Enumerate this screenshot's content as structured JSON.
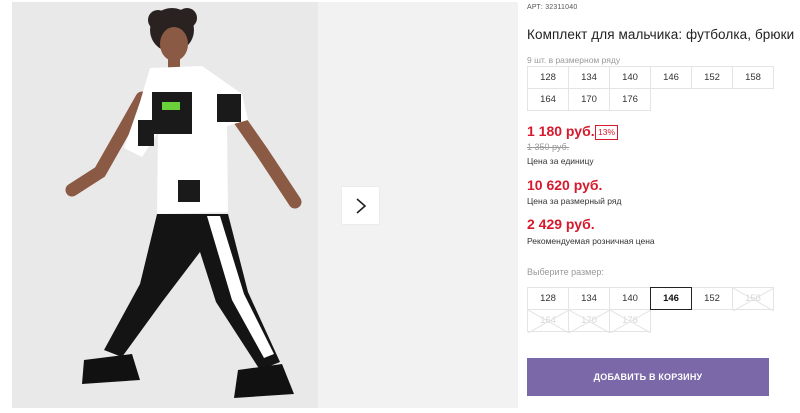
{
  "product": {
    "sku_label": "АРТ:",
    "sku_value": "32311040",
    "title": "Комплект для мальчика: футболка, брюки",
    "pack_note": "9 шт. в размерном ряду"
  },
  "size_row": [
    "128",
    "134",
    "140",
    "146",
    "152",
    "158",
    "164",
    "170",
    "176"
  ],
  "pricing": {
    "unit_price": "1 180 руб.",
    "discount": "13%",
    "old_price": "1 350 руб.",
    "unit_caption": "Цена за единицу",
    "row_price": "10 620 руб.",
    "row_caption": "Цена за размерный ряд",
    "rrp_price": "2 429 руб.",
    "rrp_caption": "Рекомендуемая розничная цена"
  },
  "size_select": {
    "label": "Выберите размер:",
    "options": [
      {
        "label": "128",
        "state": "available"
      },
      {
        "label": "134",
        "state": "available"
      },
      {
        "label": "140",
        "state": "available"
      },
      {
        "label": "146",
        "state": "selected"
      },
      {
        "label": "152",
        "state": "available"
      },
      {
        "label": "158",
        "state": "disabled"
      },
      {
        "label": "164",
        "state": "disabled"
      },
      {
        "label": "170",
        "state": "disabled"
      },
      {
        "label": "176",
        "state": "disabled"
      }
    ]
  },
  "cart": {
    "add_label": "ДОБАВИТЬ В КОРЗИНУ"
  },
  "gallery": {
    "next_icon": "chevron-right-icon"
  },
  "colors": {
    "price": "#d6192d",
    "button": "#7b68a8",
    "border": "#e4e4e4"
  }
}
